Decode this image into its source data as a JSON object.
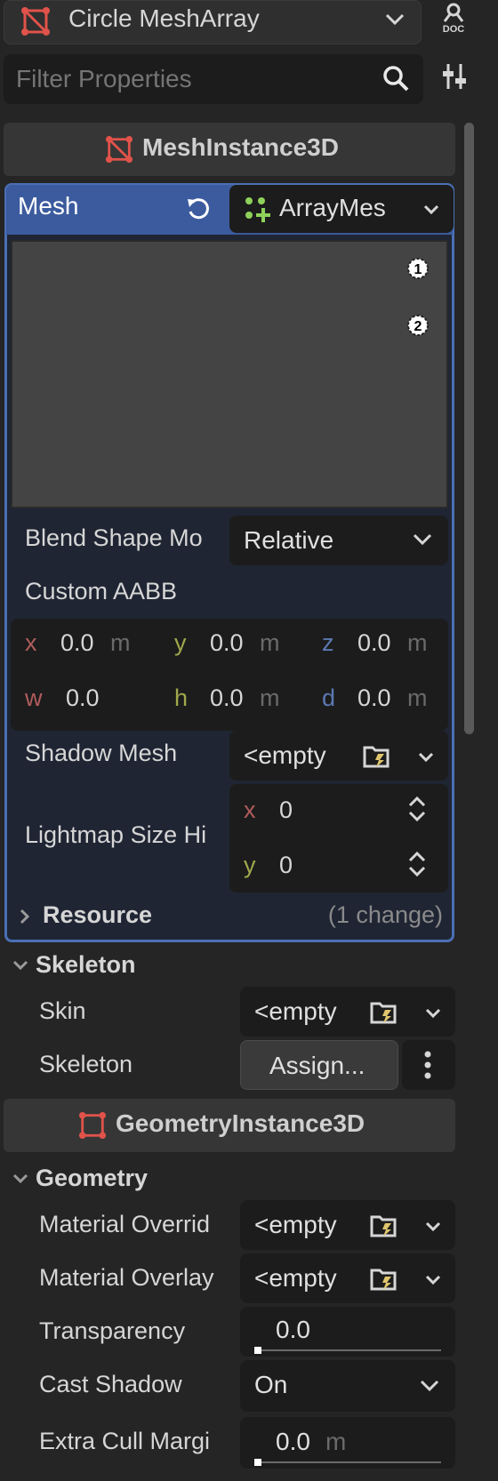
{
  "header": {
    "node_name": "Circle MeshArray",
    "filter_placeholder": "Filter Properties"
  },
  "sections": {
    "mesh_instance": "MeshInstance3D",
    "geometry_instance": "GeometryInstance3D"
  },
  "mesh": {
    "label": "Mesh",
    "resource_label": "ArrayMes",
    "blend_shape_label": "Blend Shape Mo",
    "blend_shape_value": "Relative",
    "custom_aabb_label": "Custom AABB",
    "aabb": {
      "x": "0.0",
      "y": "0.0",
      "z": "0.0",
      "w": "0.0",
      "h": "0.0",
      "d": "0.0",
      "unit": "m",
      "x_label": "x",
      "y_label": "y",
      "z_label": "z",
      "w_label": "w",
      "h_label": "h",
      "d_label": "d"
    },
    "shadow_mesh_label": "Shadow Mesh",
    "shadow_mesh_value": "<empty",
    "lightmap_label": "Lightmap Size Hi",
    "lightmap_x": "0",
    "lightmap_y": "0",
    "lightmap_x_label": "x",
    "lightmap_y_label": "y",
    "resource_group": "Resource",
    "resource_changes": "(1 change)"
  },
  "skeleton": {
    "group": "Skeleton",
    "skin_label": "Skin",
    "skin_value": "<empty",
    "skeleton_label": "Skeleton",
    "skeleton_value": "Assign..."
  },
  "geometry": {
    "group": "Geometry",
    "material_override_label": "Material Overrid",
    "material_override_value": "<empty",
    "material_overlay_label": "Material Overlay",
    "material_overlay_value": "<empty",
    "transparency_label": "Transparency",
    "transparency_value": "0.0",
    "cast_shadow_label": "Cast Shadow",
    "cast_shadow_value": "On",
    "extra_cull_label": "Extra Cull Margi",
    "extra_cull_value": "0.0",
    "extra_cull_unit": "m"
  },
  "colors": {
    "accent": "#3c5b9e",
    "node_icon": "#e0534a",
    "mesh_icon": "#8ed25b"
  },
  "icons": [
    "mesh-instance-icon",
    "chevron-down-icon",
    "doc-icon",
    "search-icon",
    "tools-icon",
    "revert-icon",
    "array-mesh-icon",
    "light1-icon",
    "light2-icon",
    "folder-icon",
    "kebab-icon",
    "stepper-icon",
    "chevron-right-icon"
  ]
}
